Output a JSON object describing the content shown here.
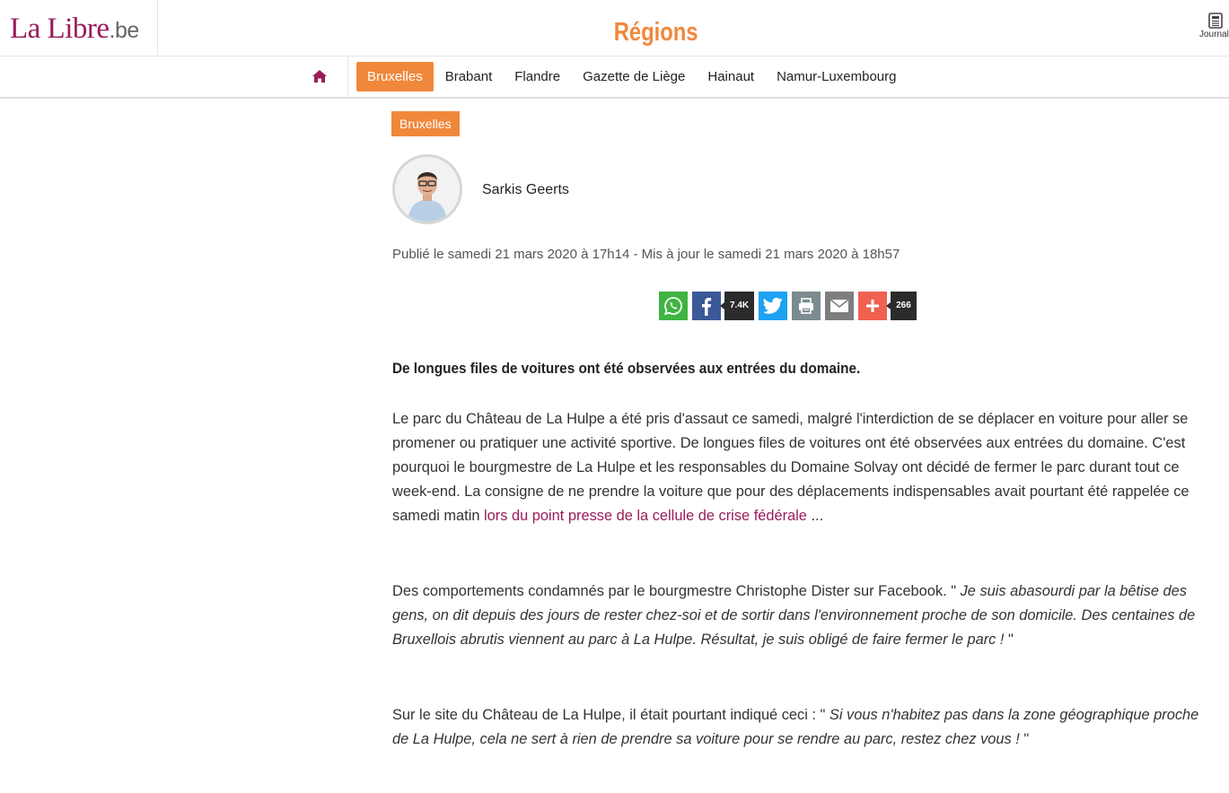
{
  "header": {
    "logo_main": "La Libre",
    "logo_suffix": ".be",
    "section_title": "Régions",
    "journal_label": "Journal"
  },
  "nav": {
    "items": [
      {
        "label": "Bruxelles",
        "active": true
      },
      {
        "label": "Brabant",
        "active": false
      },
      {
        "label": "Flandre",
        "active": false
      },
      {
        "label": "Gazette de Liège",
        "active": false
      },
      {
        "label": "Hainaut",
        "active": false
      },
      {
        "label": "Namur-Luxembourg",
        "active": false
      }
    ]
  },
  "article": {
    "tag": "Bruxelles",
    "author": "Sarkis Geerts",
    "dates": "Publié le samedi 21 mars 2020 à 17h14 - Mis à jour le samedi 21 mars 2020 à 18h57",
    "share": {
      "facebook_count": "7.4K",
      "more_count": "266"
    },
    "lead": "De longues files de voitures ont été observées aux entrées du domaine.",
    "p1_text": "Le parc du Château de La Hulpe a été pris d'assaut ce samedi, malgré l'interdiction de se déplacer en voiture pour aller se promener ou pratiquer une activité sportive. De longues files de voitures ont été observées aux entrées du domaine. C'est pourquoi le bourgmestre de La Hulpe et les responsables du Domaine Solvay ont décidé de fermer le parc durant tout ce week-end. La consigne de ne prendre la voiture que pour des déplacements indispensables avait pourtant été rappelée ce samedi matin ",
    "p1_link": "lors du point presse de la cellule de crise fédérale",
    "p1_tail": " ...",
    "p2_text": "Des comportements condamnés par le bourgmestre Christophe Dister sur Facebook. \" ",
    "p2_quote": "Je suis abasourdi par la bêtise des gens, on dit depuis des jours de rester chez-soi et de sortir dans l'environnement proche de son domicile. Des centaines de Bruxellois abrutis viennent au parc à La Hulpe. Résultat, je suis obligé de faire fermer le parc ! ",
    "p2_tail": "\"",
    "p3_text": "Sur le site du Château de La Hulpe, il était pourtant indiqué ceci : \" ",
    "p3_quote": "Si vous n'habitez pas dans la zone géographique proche de La Hulpe, cela ne sert à rien de prendre sa voiture pour se rendre au parc, restez chez vous ! ",
    "p3_tail": "\""
  },
  "colors": {
    "brand": "#9b1c5a",
    "accent": "#f0883c"
  }
}
